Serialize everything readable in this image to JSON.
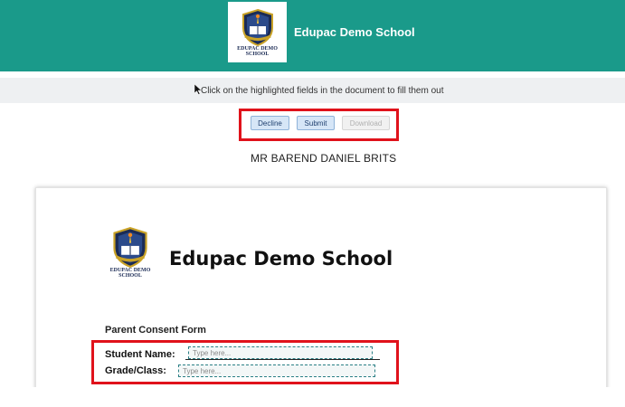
{
  "header": {
    "title": "Edupac Demo School",
    "logo_text_line1": "EDUPAC DEMO",
    "logo_text_line2": "SCHOOL",
    "background_color": "#1a9a8a"
  },
  "instruction": {
    "text": "Click on the highlighted fields in the document to fill them out",
    "icon": "cursor-icon"
  },
  "toolbar": {
    "decline_label": "Decline",
    "submit_label": "Submit",
    "download_label": "Download",
    "highlight_color": "#e0121b"
  },
  "signer": {
    "name": "MR BAREND DANIEL BRITS"
  },
  "document": {
    "school_name": "Edupac Demo School",
    "logo_text_line1": "EDUPAC DEMO",
    "logo_text_line2": "SCHOOL",
    "form_title": "Parent Consent Form",
    "fields": {
      "student_name": {
        "label": "Student Name:",
        "placeholder": "Type here...",
        "value": ""
      },
      "grade_class": {
        "label": "Grade/Class:",
        "placeholder": "Type here...",
        "value": ""
      }
    }
  }
}
